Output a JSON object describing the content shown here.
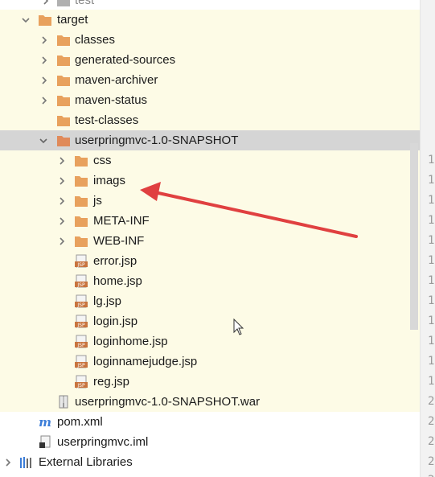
{
  "tree": {
    "top_partial_label": "test",
    "target_label": "target",
    "classes_label": "classes",
    "generated_sources_label": "generated-sources",
    "maven_archiver_label": "maven-archiver",
    "maven_status_label": "maven-status",
    "test_classes_label": "test-classes",
    "snapshot_folder_label": "userpringmvc-1.0-SNAPSHOT",
    "css_label": "css",
    "imags_label": "imags",
    "js_label": "js",
    "meta_inf_label": "META-INF",
    "web_inf_label": "WEB-INF",
    "jsp_files": [
      "error.jsp",
      "home.jsp",
      "lg.jsp",
      "login.jsp",
      "loginhome.jsp",
      "loginnamejudge.jsp",
      "reg.jsp"
    ],
    "war_label": "userpringmvc-1.0-SNAPSHOT.war",
    "pom_label": "pom.xml",
    "iml_label": "userpringmvc.iml",
    "external_libraries_label": "External Libraries"
  },
  "gutter": {
    "line_numbers": [
      "1",
      "1",
      "1",
      "1",
      "1",
      "1",
      "1",
      "1",
      "1",
      "1",
      "1",
      "1",
      "2",
      "2",
      "2",
      "2",
      "2"
    ]
  },
  "icons": {
    "folder": "folder-icon",
    "jsp": "jsp-file-icon",
    "war": "war-archive-icon",
    "maven": "maven-icon",
    "iml": "iml-module-icon",
    "libraries": "libraries-icon"
  },
  "colors": {
    "folder": "#e8a15d",
    "build_row_bg": "#fdfbe6",
    "selection_bg": "#d5d5d5",
    "arrow": "#e04040",
    "maven_blue": "#3b7dd8"
  }
}
